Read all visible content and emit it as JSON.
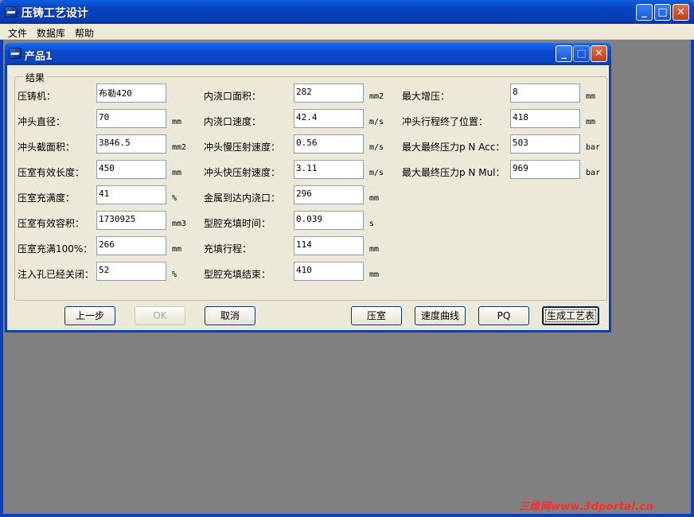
{
  "window": {
    "title": "压铸工艺设计"
  },
  "menu": [
    "文件",
    "数据库",
    "帮助"
  ],
  "inner_window": {
    "title": "产品1"
  },
  "group_title": "结果",
  "col1": [
    {
      "label": "压铸机：",
      "value": "布勒420",
      "unit": ""
    },
    {
      "label": "冲头直径：",
      "value": "70",
      "unit": "mm"
    },
    {
      "label": "冲头截面积：",
      "value": "3846.5",
      "unit": "mm2"
    },
    {
      "label": "压室有效长度：",
      "value": "450",
      "unit": "mm"
    },
    {
      "label": "压室充满度：",
      "value": "41",
      "unit": "%"
    },
    {
      "label": "压室有效容积：",
      "value": "1730925",
      "unit": "mm3"
    },
    {
      "label": "压室充满100%：",
      "value": "266",
      "unit": "mm"
    },
    {
      "label": "注入孔已经关闭：",
      "value": "52",
      "unit": "%"
    }
  ],
  "col2": [
    {
      "label": "内浇口面积：",
      "value": "282",
      "unit": "mm2"
    },
    {
      "label": "内浇口速度：",
      "value": "42.4",
      "unit": "m/s"
    },
    {
      "label": "冲头慢压射速度：",
      "value": "0.56",
      "unit": "m/s"
    },
    {
      "label": "冲头快压射速度：",
      "value": "3.11",
      "unit": "m/s"
    },
    {
      "label": "金属到达内浇口：",
      "value": "296",
      "unit": "mm"
    },
    {
      "label": "型腔充填时间：",
      "value": "0.039",
      "unit": "s"
    },
    {
      "label": "充填行程：",
      "value": "114",
      "unit": "mm"
    },
    {
      "label": "型腔充填结束：",
      "value": "410",
      "unit": "mm"
    }
  ],
  "col3": [
    {
      "label": "最大增压：",
      "value": "8",
      "unit": "mm"
    },
    {
      "label": "冲头行程终了位置：",
      "value": "418",
      "unit": "mm"
    },
    {
      "label": "最大最终压力p N Acc：",
      "value": "503",
      "unit": "bar"
    },
    {
      "label": "最大最终压力p N Mul：",
      "value": "969",
      "unit": "bar"
    }
  ],
  "buttons": {
    "prev": "上一步",
    "ok": "OK",
    "cancel": "取消",
    "chamber": "压室",
    "speed_curve": "速度曲线",
    "pq": "PQ",
    "generate": "生成工艺表"
  },
  "watermark": "三维网www.3dportal.cn"
}
